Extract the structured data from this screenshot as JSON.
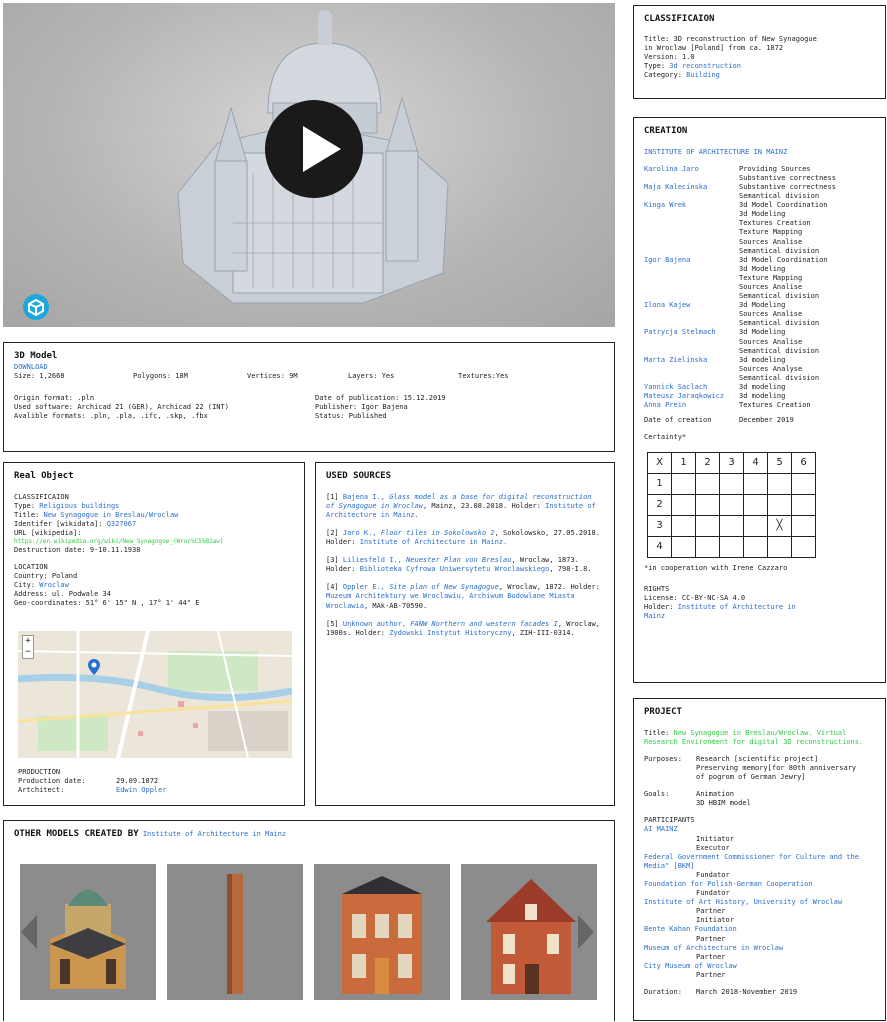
{
  "viewer": {
    "label": "3D model viewer"
  },
  "classification": {
    "title": "CLASSIFICAION",
    "lines": [
      {
        "k": "Title: ",
        "v": "3D reconstruction of New Synagogue"
      },
      {
        "k": "",
        "v": "in Wroclaw [Poland] from  ca. 1872"
      },
      {
        "k": "Version: ",
        "v": "1.0"
      }
    ],
    "type_label": "Type: ",
    "type_value": "3d reconstruction",
    "category_label": "Category: ",
    "category_value": "Building"
  },
  "creation": {
    "title": "CREATION",
    "institute": "INSTITUTE OF ARCHITECTURE IN MAINZ",
    "people": [
      {
        "name": "Karolina Jaro",
        "roles": [
          "Providing Sources",
          "Substantive correctness"
        ]
      },
      {
        "name": "Maja Kalecinska",
        "roles": [
          "Substantive correctness",
          "Semantical division"
        ]
      },
      {
        "name": "Kinga Wrek",
        "roles": [
          "3d Model Coordination",
          "3d Modeling",
          "Textures Creation",
          "Texture Mapping",
          "Sources Analise",
          "Semantical division"
        ]
      },
      {
        "name": "Igor Bajena",
        "roles": [
          "3d Model Coordination",
          "3d Modeling",
          "Texture Mapping",
          "Sources Analise",
          "Semantical division"
        ]
      },
      {
        "name": "Ilona Kajew",
        "roles": [
          "3d Modeling",
          "Sources Analise",
          "Semantical division"
        ]
      },
      {
        "name": "Patrycja Stelmach",
        "roles": [
          "3d Modeling",
          "Sources Analise",
          "Semantical division"
        ]
      },
      {
        "name": "Marta Zielinska",
        "roles": [
          "3d modeling",
          "Sources Analyse",
          "Semantical division"
        ]
      },
      {
        "name": "Yannick Saclach",
        "roles": [
          "3d modeling"
        ]
      },
      {
        "name": "Mateusz Jaraqkowicz",
        "roles": [
          "3d modeling"
        ]
      },
      {
        "name": "Anna Prein",
        "roles": [
          "Textures Creation"
        ]
      }
    ],
    "date_label": "Date of creation",
    "date_value": "December 2019",
    "certainty_label": "Certainty*",
    "grid_header": [
      "X",
      "1",
      "2",
      "3",
      "4",
      "5",
      "6"
    ],
    "grid_rows": [
      "1",
      "2",
      "3",
      "4"
    ],
    "grid_mark": "╳",
    "coop_note": "*in cooperation with Irene Cazzaro",
    "rights_title": "RIGHTS",
    "license": "License: CC-BY-NC-SA 4.0",
    "holder_label": "Holder: ",
    "holder_value": "Institute of Architecture in",
    "holder_value2": "Mainz"
  },
  "model": {
    "title": "3D Model",
    "download": "DOWNLOAD",
    "size": "Size: 1,2668",
    "polygons": "Polygons: 18M",
    "vertices": "Vertices: 9M",
    "layers": "Layers: Yes",
    "textures": "Textures:Yes",
    "origin": "Origin format: .pln",
    "software": "Used software: Archicad 21 (GER), Archicad 22 (INT)",
    "formats": "Avalible formats: .pln, .pla, .ifc, .skp, .fbx",
    "pubdate": "Date of publication: 15.12.2019",
    "publisher": "Publisher: Igor Bajena",
    "status": "Status: Published"
  },
  "real_object": {
    "title": "Real Object",
    "class_title": "CLASSIFICAION",
    "type_label": "Type: ",
    "type_value": "Religious buildings",
    "title_label": "Title: ",
    "title_value": "New Synagogue in  Breslau/Wroclaw",
    "wikidata_label": "Identifer [wikidata]: ",
    "wikidata_value": "Q327067",
    "url_label": "URL [wikipedia]:",
    "url_value": "https://en.wikipedia.org/wiki/New_Synagogue_(Wroc%C5%82aw)",
    "destruction": "Destruction date: 9-10.11.1938",
    "location_title": "LOCATION",
    "country": "Country: Poland",
    "city_label": "City: ",
    "city_value": "Wroclaw",
    "address": "Address: ul. Podwale 34",
    "geo": "Geo-coordinates: 51° 6' 15\" N , 17° 1' 44\" E",
    "production_title": "PRODUCTION",
    "prod_date_label": "Production date:",
    "prod_date_value": "29.09.1872",
    "architect_label": "Artchitect:",
    "architect_value": "Edwin Oppler"
  },
  "sources": {
    "title": "USED SOURCES",
    "items": [
      {
        "n": "[1] ",
        "a": "Bajena I., ",
        "t": "Glass model as a base for digital reconstruction of Synagogue in Wroclaw",
        "r": ", Mainz, 23.08.2018. Holder: ",
        "h": "Institute of Architecture in Mainz."
      },
      {
        "n": "[2] ",
        "a": "Jaro K., ",
        "t": "Floor tiles in Sokolowsko 2",
        "r": ", Sokolowsko, 27.05.2018. Holder: ",
        "h": "Institute of Architecture in Mainz."
      },
      {
        "n": "[3] ",
        "a": "Liliesfeld I., ",
        "t": "Neuester Plan von Breslau",
        "r": ", Wroclaw, 1873. Holder: ",
        "h": "Biblioteka Cyfrowa Uniwersytetu Wroclawskiego",
        "e": ", 798-I.8."
      },
      {
        "n": "[4] ",
        "a": "Oppler E., ",
        "t": "Site plan of New Synagogue",
        "r": ", Wroclaw, 1872. Holder: ",
        "h": "Muzeum Architektury we Wroclawiu, Archiwum Budowlane Miasta Wroclawia",
        "e": ", MAk-AB-70590."
      },
      {
        "n": "[5] ",
        "a": "Unknown author, ",
        "t": "FANW Northern and western facades I",
        "r": ", Wroclaw, 1900s. Holder: ",
        "h": "Zydowski Instytut Historyczny",
        "e": ", ZIH-III-0314."
      }
    ]
  },
  "project": {
    "title": "PROJECT",
    "title_label": "Title: ",
    "title_value": "New Synagogue in Breslau/Wroclaw. Virtual Research Environment for digital 3D reconstructions.",
    "purposes_label": "Purposes:",
    "purposes": [
      "Research [scientific project]",
      "Preserving memory[for 80th anniversary",
      "of pogrom of German Jewry]"
    ],
    "goals_label": "Goals:",
    "goals": [
      "Animation",
      "3D HBIM model"
    ],
    "participants_title": "PARTICIPANTS",
    "participants": [
      {
        "name": "AI MAINZ",
        "roles": [
          "Initiator",
          "Executor"
        ]
      },
      {
        "name": "Federal Government Commissioner for Culture and the Media\" [BKM]",
        "roles": [
          "Fundator"
        ]
      },
      {
        "name": "Foundation for Polish-German Cooperation",
        "roles": [
          "Fundator"
        ]
      },
      {
        "name": "Institute of Art History, University of Wroclaw",
        "roles": [
          "Partner",
          "Initiator"
        ]
      },
      {
        "name": "Bente Kahan Foundation",
        "roles": [
          "Partner"
        ]
      },
      {
        "name": "Museum of Architecture in Wroclaw",
        "roles": [
          "Partner"
        ]
      },
      {
        "name": "City Museum of Wroclaw",
        "roles": [
          "Partner"
        ]
      }
    ],
    "duration_label": "Duration:",
    "duration_value": "March 2018-November 2019"
  },
  "other_models": {
    "title": "OTHER MODELS CREATED BY",
    "creator": "Institute of Architecture in Mainz"
  },
  "colors": {
    "link": "#2a6fcf",
    "green_link": "#2ecc40",
    "sketchfab": "#1ca8dd"
  }
}
